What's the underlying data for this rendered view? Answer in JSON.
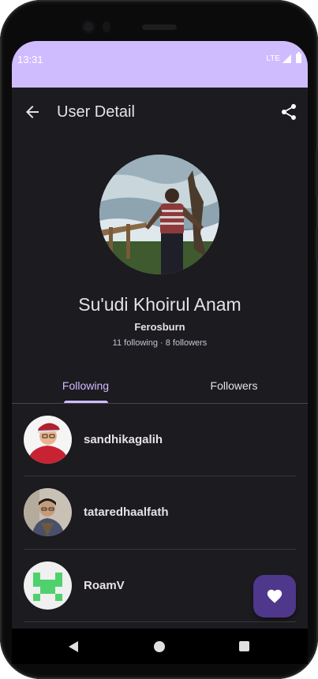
{
  "status_bar": {
    "time": "13:31",
    "network": "LTE"
  },
  "app_bar": {
    "title": "User Detail",
    "back_icon": "arrow-back-icon",
    "share_icon": "share-icon"
  },
  "profile": {
    "name": "Su'udi Khoirul Anam",
    "username": "Ferosburn",
    "stats": "11 following · 8 followers"
  },
  "tabs": {
    "following": "Following",
    "followers": "Followers",
    "selected": "Following"
  },
  "users": [
    {
      "login": "sandhikagalih"
    },
    {
      "login": "tataredhaalfath"
    },
    {
      "login": "RoamV"
    }
  ],
  "fab": {
    "icon": "heart-icon"
  },
  "colors": {
    "status_bar": "#cfbcff",
    "background": "#1c1b1f",
    "accent": "#cfbcff",
    "fab": "#4f378b"
  }
}
